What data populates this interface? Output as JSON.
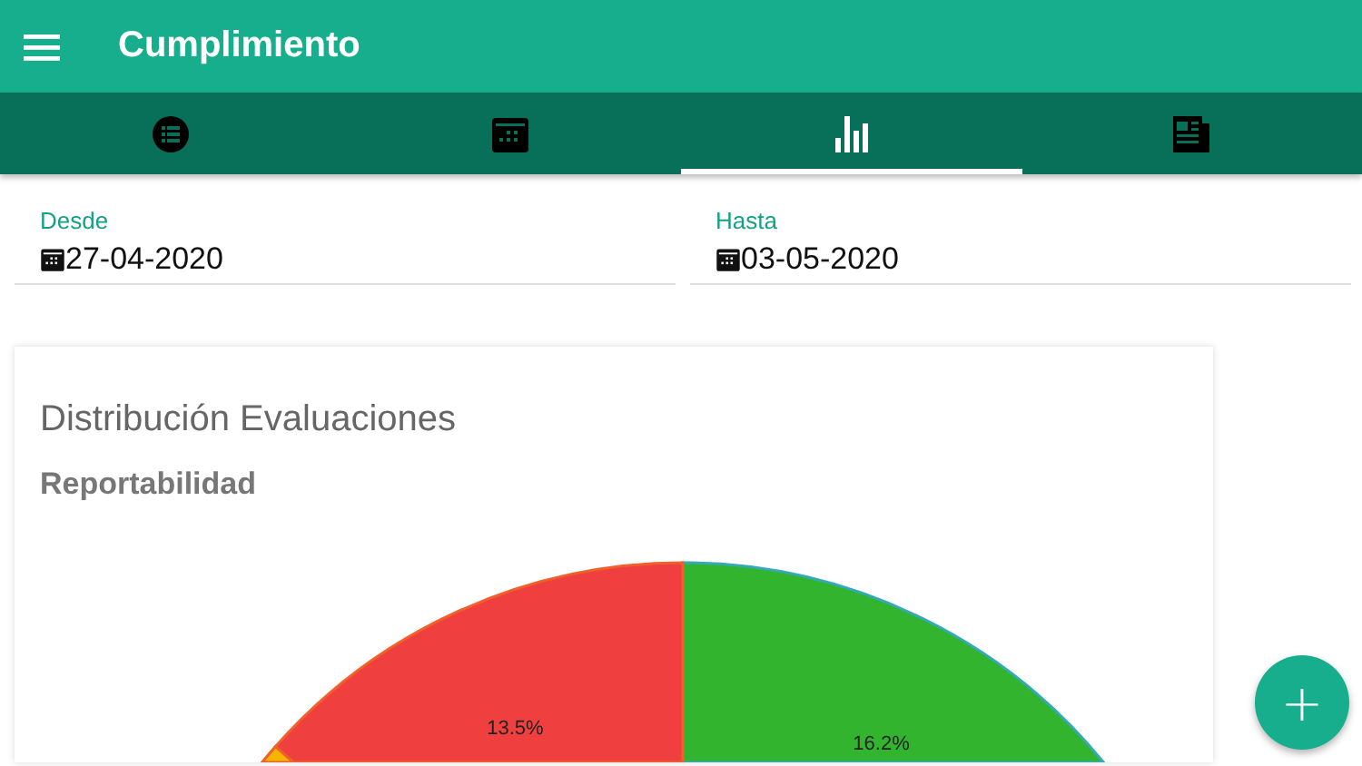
{
  "app_bar": {
    "title": "Cumplimiento"
  },
  "tabs": [
    {
      "kind": "list",
      "selected": false
    },
    {
      "kind": "calendar",
      "selected": false
    },
    {
      "kind": "chart",
      "selected": true
    },
    {
      "kind": "news",
      "selected": false
    }
  ],
  "date_fields": [
    {
      "label": "Desde",
      "value": "27-04-2020"
    },
    {
      "label": "Hasta",
      "value": "03-05-2020"
    }
  ],
  "card": {
    "title": "Distribución Evaluaciones",
    "subtitle": "Reportabilidad",
    "pie_slices": [
      {
        "label": "16.2%",
        "color": "#33b42f"
      },
      {
        "label": "13.5%",
        "color": "#ef3f3f"
      },
      {
        "color": "#f5b400"
      }
    ]
  },
  "fab": {
    "label": "+"
  }
}
